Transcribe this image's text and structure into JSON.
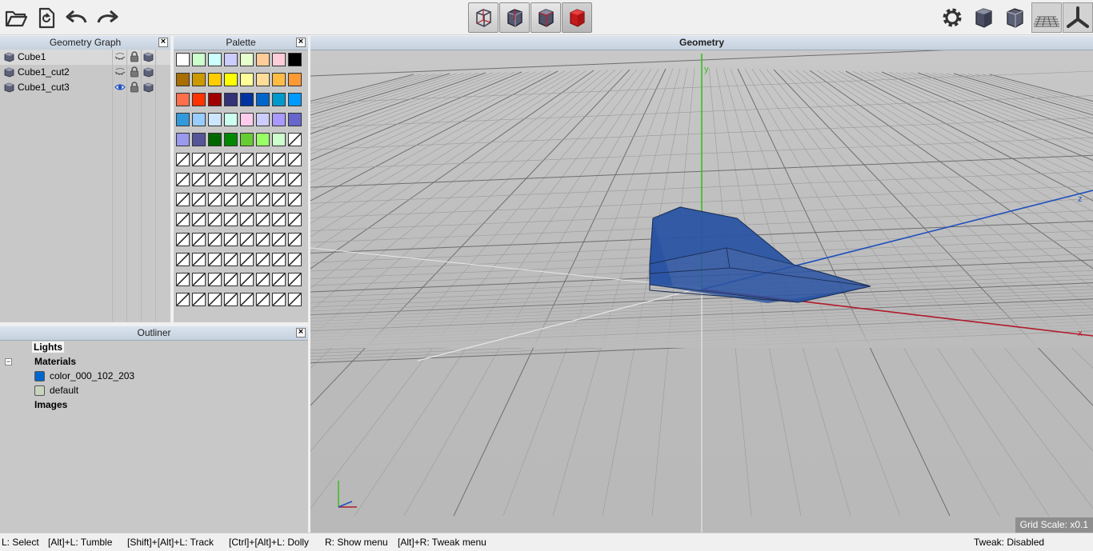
{
  "toolbar": {
    "left_buttons": [
      "open-folder-icon",
      "reload-icon",
      "undo-icon",
      "redo-icon"
    ],
    "view_modes": [
      "wireframe-cube-icon",
      "shaded-wire-cube-icon",
      "shaded-cube-icon",
      "solid-red-cube-icon"
    ],
    "right_buttons": [
      "settings-icon",
      "shaded-cube-icon",
      "wireframe-cube-icon",
      "grid-icon",
      "axes-icon"
    ]
  },
  "geometry_graph": {
    "title": "Geometry Graph",
    "items": [
      {
        "label": "Cube1",
        "visible": false,
        "selected": true
      },
      {
        "label": "Cube1_cut2",
        "visible": false,
        "selected": false
      },
      {
        "label": "Cube1_cut3",
        "visible": true,
        "selected": false
      }
    ]
  },
  "palette": {
    "title": "Palette",
    "swatches": [
      "#ffffff",
      "#ccffcc",
      "#ccffff",
      "#ccccff",
      "#e6ffcc",
      "#ffcc99",
      "#ffccd9",
      "#000000",
      "#a86e00",
      "#cc9900",
      "#ffcc00",
      "#ffff00",
      "#ffff99",
      "#ffdd99",
      "#ffbb44",
      "#ff9933",
      "#ff6f4c",
      "#ff3300",
      "#a00000",
      "#333377",
      "#0033a0",
      "#0066cc",
      "#0099cc",
      "#0099ff",
      "#3399dd",
      "#99ccff",
      "#cce6ff",
      "#ccffee",
      "#ffccee",
      "#ccccff",
      "#aa99ff",
      "#6666cc",
      "#9999ee",
      "#555599",
      "#006600",
      "#008800",
      "#66cc33",
      "#99ff66",
      "#ccffcc",
      null,
      null,
      null,
      null,
      null,
      null,
      null,
      null,
      null,
      null,
      null,
      null,
      null,
      null,
      null,
      null,
      null,
      null,
      null,
      null,
      null,
      null,
      null,
      null,
      null,
      null,
      null,
      null,
      null,
      null,
      null,
      null,
      null,
      null,
      null,
      null,
      null,
      null,
      null,
      null,
      null,
      null,
      null,
      null,
      null,
      null,
      null,
      null,
      null,
      null,
      null,
      null,
      null,
      null,
      null,
      null,
      null,
      null,
      null,
      null,
      null,
      null,
      null,
      null,
      null
    ]
  },
  "outliner": {
    "title": "Outliner",
    "lights_label": "Lights",
    "materials_label": "Materials",
    "materials": [
      {
        "label": "color_000_102_203",
        "color": "#0066cb"
      },
      {
        "label": "default",
        "color": "#c9d4bf"
      }
    ],
    "images_label": "Images"
  },
  "viewport": {
    "title": "Geometry",
    "axis_labels": {
      "y": "y",
      "z": "z",
      "x": "x"
    },
    "grid_scale": "Grid Scale: x0.1",
    "object_color": "#2a54a3",
    "axis_colors": {
      "x": "#b21a2b",
      "y": "#3cbd22",
      "z": "#1f4fbe"
    }
  },
  "status": {
    "hints": [
      "L: Select",
      "[Alt]+L: Tumble",
      "[Shift]+[Alt]+L: Track",
      "[Ctrl]+[Alt]+L: Dolly",
      "R: Show menu",
      "[Alt]+R: Tweak menu"
    ],
    "tweak": "Tweak: Disabled"
  }
}
